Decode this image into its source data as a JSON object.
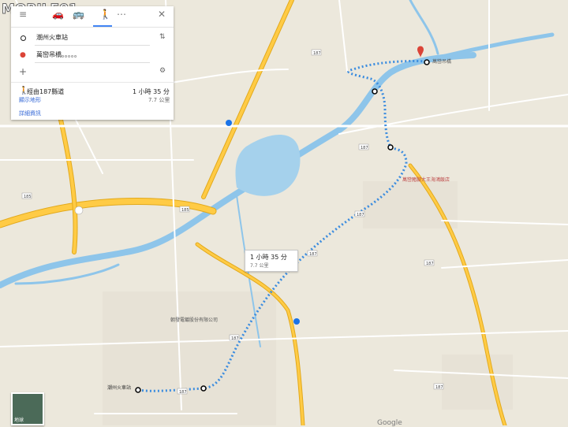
{
  "logo": {
    "text": "MOBILE01"
  },
  "panel": {
    "origin_text": "潮州火車站",
    "destination_text": "萬巒吊橋。。。。。",
    "route_title": "經由187縣道",
    "route_time": "1 小時 35 分",
    "route_subtitle": "顯示地形",
    "route_distance": "7.7 公里",
    "details_link": "詳細資訊"
  },
  "callout": {
    "time": "1 小時 35 分",
    "distance": "7.7 公里"
  },
  "map_labels": {
    "factory": "朝發電鍍股份有限公司",
    "restaurant": "萬巒豬腳大王海鴻飯店",
    "suspension_bridge": "萬巒吊橋",
    "station": "潮州火車站",
    "thumb_label": "地球",
    "google": "Google"
  },
  "road_shields": [
    "187",
    "187",
    "187",
    "187",
    "187",
    "187",
    "187",
    "187",
    "185",
    "185",
    "1",
    "3",
    "88"
  ],
  "colors": {
    "map_bg": "#ece8dc",
    "river": "#8ec5ea",
    "lake": "#a5d1ec",
    "highway": "#ffcb45",
    "highway_edge": "#e2a91c",
    "route_dots": "#3b8cdf",
    "marker_red": "#db4437"
  }
}
